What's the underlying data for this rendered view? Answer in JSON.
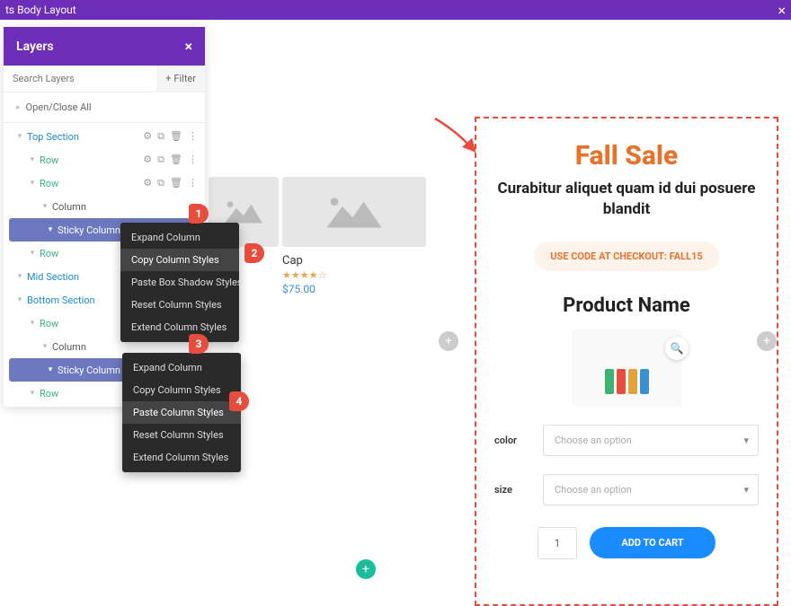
{
  "topbar": {
    "title": "ts Body Layout"
  },
  "layers": {
    "header": "Layers",
    "search_placeholder": "Search Layers",
    "filter": "Filter",
    "open_close": "Open/Close All",
    "tree": [
      {
        "label": "Top Section",
        "lvl": 0,
        "cls": "sect",
        "icons": true
      },
      {
        "label": "Row",
        "lvl": 1,
        "cls": "row",
        "icons": true
      },
      {
        "label": "Row",
        "lvl": 1,
        "cls": "row",
        "icons": true
      },
      {
        "label": "Column",
        "lvl": 2,
        "cls": "col"
      },
      {
        "label": "Sticky Column 1",
        "lvl": 2,
        "cls": "sel",
        "icons": true
      },
      {
        "label": "Row",
        "lvl": 1,
        "cls": "row"
      },
      {
        "label": "Mid Section",
        "lvl": 0,
        "cls": "sect"
      },
      {
        "label": "Bottom Section",
        "lvl": 0,
        "cls": "sect",
        "icons": true
      },
      {
        "label": "Row",
        "lvl": 1,
        "cls": "row"
      },
      {
        "label": "Column",
        "lvl": 2,
        "cls": "col"
      },
      {
        "label": "Sticky Column 2",
        "lvl": 2,
        "cls": "sel",
        "icons": true
      },
      {
        "label": "Row",
        "lvl": 1,
        "cls": "row"
      }
    ]
  },
  "ctx1": {
    "items": [
      "Expand Column",
      "Copy Column Styles",
      "Paste Box Shadow Styles",
      "Reset Column Styles",
      "Extend Column Styles"
    ],
    "highlight": 1
  },
  "ctx2": {
    "items": [
      "Expand Column",
      "Copy Column Styles",
      "Paste Column Styles",
      "Reset Column Styles",
      "Extend Column Styles"
    ],
    "highlight": 2
  },
  "markers": {
    "m1": "1",
    "m2": "2",
    "m3": "3",
    "m4": "4"
  },
  "product": {
    "title": "Cap",
    "price": "$75.00",
    "stars": "★★★★☆"
  },
  "promo": {
    "title": "Fall Sale",
    "subtitle": "Curabitur aliquet quam id dui posuere blandit",
    "coupon": "USE CODE AT CHECKOUT: FALL15",
    "product": "Product Name",
    "color_label": "color",
    "size_label": "size",
    "option_placeholder": "Choose an option",
    "qty": "1",
    "add": "ADD TO CART"
  }
}
